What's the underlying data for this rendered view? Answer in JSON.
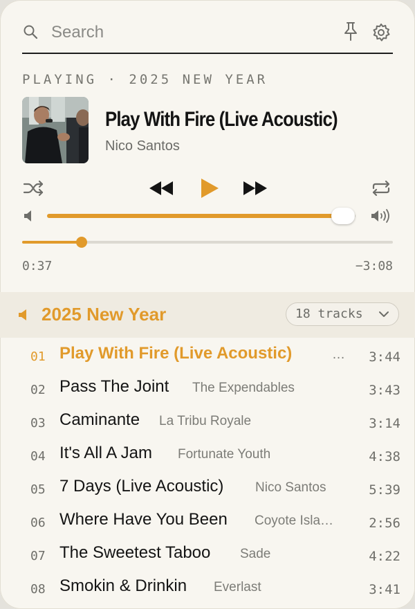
{
  "search": {
    "placeholder": "Search"
  },
  "now_playing": {
    "label": "PLAYING · 2025 NEW YEAR",
    "title": "Play With Fire (Live Acoustic)",
    "artist": "Nico Santos",
    "volume": 0.96,
    "progress": 0.16,
    "elapsed": "0:37",
    "remaining": "−3:08"
  },
  "playlist": {
    "name": "2025 New Year",
    "track_count": "18 tracks",
    "tracks": [
      {
        "num": "01",
        "title": "Play With Fire (Live Acoustic)",
        "artist": "…",
        "duration": "3:44",
        "active": true
      },
      {
        "num": "02",
        "title": "Pass The Joint",
        "artist": "The Expendables",
        "duration": "3:43"
      },
      {
        "num": "03",
        "title": "Caminante",
        "artist": "La Tribu Royale",
        "duration": "3:14"
      },
      {
        "num": "04",
        "title": "It's All A Jam",
        "artist": "Fortunate Youth",
        "duration": "4:38"
      },
      {
        "num": "05",
        "title": "7 Days (Live Acoustic)",
        "artist": "Nico Santos",
        "duration": "5:39"
      },
      {
        "num": "06",
        "title": "Where Have You Been",
        "artist": "Coyote Isla…",
        "duration": "2:56"
      },
      {
        "num": "07",
        "title": "The Sweetest Taboo",
        "artist": "Sade",
        "duration": "4:22"
      },
      {
        "num": "08",
        "title": "Smokin & Drinkin",
        "artist": "Everlast",
        "duration": "3:41"
      }
    ]
  },
  "colors": {
    "accent": "#e19a2b",
    "background": "#f8f6f0",
    "text": "#141414"
  },
  "icons": [
    "search-icon",
    "pin-icon",
    "gear-icon",
    "shuffle-icon",
    "rewind-icon",
    "play-icon",
    "fast-forward-icon",
    "repeat-icon",
    "volume-low-icon",
    "volume-high-icon",
    "speaker-icon",
    "chevron-down-icon"
  ]
}
